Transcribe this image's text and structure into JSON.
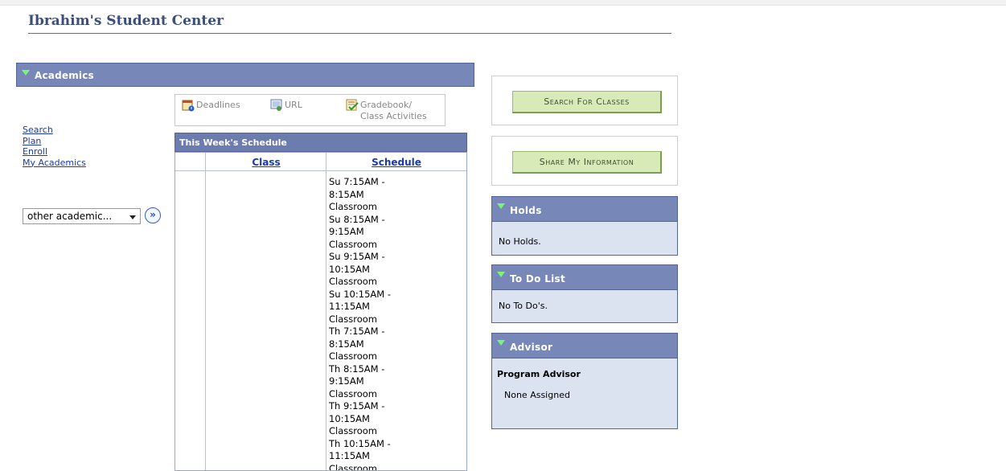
{
  "page": {
    "title": "Ibrahim's Student Center"
  },
  "academics": {
    "header": "Academics",
    "links": [
      "Search",
      "Plan",
      "Enroll",
      "My Academics"
    ],
    "other_select_value": "other academic...",
    "tools": {
      "deadlines": "Deadlines",
      "url": "URL",
      "gradebook_line1": "Gradebook/",
      "gradebook_line2": "Class Activities"
    },
    "schedule": {
      "header": "This Week's Schedule",
      "col_class": "Class",
      "col_schedule": "Schedule",
      "lines": [
        "Su 7:15AM -",
        "8:15AM",
        "Classroom",
        "Su 8:15AM -",
        "9:15AM",
        "Classroom",
        "Su 9:15AM -",
        "10:15AM",
        "Classroom",
        "Su 10:15AM -",
        "11:15AM",
        "Classroom",
        "Th 7:15AM -",
        "8:15AM",
        "Classroom",
        "Th 8:15AM -",
        "9:15AM",
        "Classroom",
        "Th 9:15AM -",
        "10:15AM",
        "Classroom",
        "Th 10:15AM -",
        "11:15AM",
        "Classroom"
      ]
    }
  },
  "buttons": {
    "search_classes": "Search For Classes",
    "share_info": "Share My Information"
  },
  "holds": {
    "header": "Holds",
    "message": "No Holds."
  },
  "todo": {
    "header": "To Do List",
    "message": "No To Do's."
  },
  "advisor": {
    "header": "Advisor",
    "title": "Program Advisor",
    "value": "None Assigned"
  },
  "colors": {
    "header_bg": "#7787b8",
    "panel_bg": "#dbe3f1",
    "button_bg": "#d7eab8",
    "link": "#1a3ba8"
  }
}
